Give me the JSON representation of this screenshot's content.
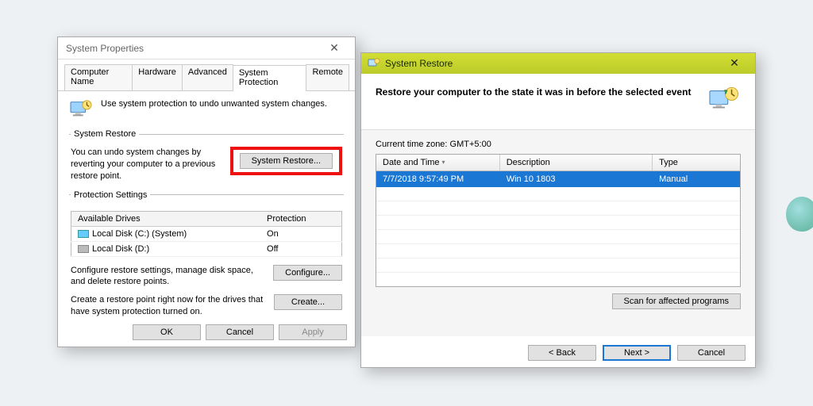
{
  "sysprop": {
    "title": "System Properties",
    "tabs": [
      "Computer Name",
      "Hardware",
      "Advanced",
      "System Protection",
      "Remote"
    ],
    "active_tab": 3,
    "intro": "Use system protection to undo unwanted system changes.",
    "group_restore": {
      "legend": "System Restore",
      "text": "You can undo system changes by reverting your computer to a previous restore point.",
      "button": "System Restore..."
    },
    "group_protect": {
      "legend": "Protection Settings",
      "col_drive": "Available Drives",
      "col_prot": "Protection",
      "drives": [
        {
          "name": "Local Disk (C:) (System)",
          "protection": "On",
          "sys": true
        },
        {
          "name": "Local Disk (D:)",
          "protection": "Off",
          "sys": false
        }
      ],
      "cfg_text": "Configure restore settings, manage disk space, and delete restore points.",
      "cfg_button": "Configure...",
      "create_text": "Create a restore point right now for the drives that have system protection turned on.",
      "create_button": "Create..."
    },
    "ok": "OK",
    "cancel": "Cancel",
    "apply": "Apply"
  },
  "restore": {
    "title": "System Restore",
    "header": "Restore your computer to the state it was in before the selected event",
    "timezone": "Current time zone: GMT+5:00",
    "cols": {
      "dt": "Date and Time",
      "de": "Description",
      "ty": "Type"
    },
    "row": {
      "dt": "7/7/2018 9:57:49 PM",
      "de": "Win 10 1803",
      "ty": "Manual"
    },
    "scan": "Scan for affected programs",
    "back": "< Back",
    "next": "Next >",
    "cancel": "Cancel"
  }
}
